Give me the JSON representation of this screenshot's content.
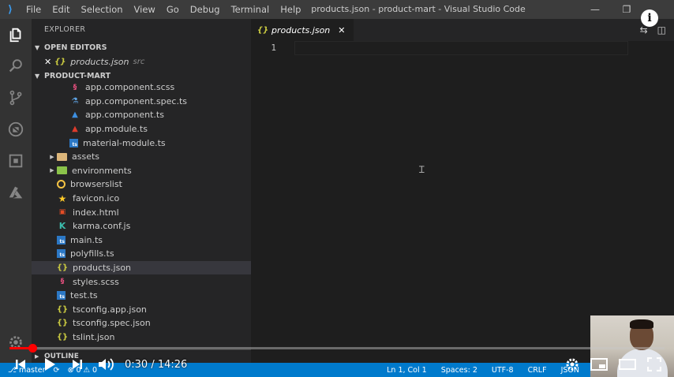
{
  "titlebar": {
    "menu": [
      "File",
      "Edit",
      "Selection",
      "View",
      "Go",
      "Debug",
      "Terminal",
      "Help"
    ],
    "window_title": "products.json - product-mart - Visual Studio Code"
  },
  "activity": [
    "files-icon",
    "search-icon",
    "source-control-icon",
    "debug-icon",
    "extensions-icon",
    "azure-icon"
  ],
  "sidebar": {
    "title": "EXPLORER",
    "open_editors_label": "OPEN EDITORS",
    "open_editor": {
      "name": "products.json",
      "desc": "src"
    },
    "project_label": "PRODUCT-MART",
    "tree": [
      {
        "name": "app.component.scss",
        "icon": "scss",
        "indent": 2
      },
      {
        "name": "app.component.spec.ts",
        "icon": "flask",
        "indent": 2
      },
      {
        "name": "app.component.ts",
        "icon": "ang-b",
        "indent": 2
      },
      {
        "name": "app.module.ts",
        "icon": "ang",
        "indent": 2
      },
      {
        "name": "material-module.ts",
        "icon": "ts",
        "indent": 2
      },
      {
        "name": "assets",
        "icon": "folder",
        "indent": 1,
        "chev": true
      },
      {
        "name": "environments",
        "icon": "folder env",
        "indent": 1,
        "chev": true
      },
      {
        "name": "browserslist",
        "icon": "circle",
        "indent": 1
      },
      {
        "name": "favicon.ico",
        "icon": "star",
        "indent": 1
      },
      {
        "name": "index.html",
        "icon": "html",
        "indent": 1
      },
      {
        "name": "karma.conf.js",
        "icon": "karma",
        "indent": 1
      },
      {
        "name": "main.ts",
        "icon": "ts",
        "indent": 1
      },
      {
        "name": "polyfills.ts",
        "icon": "ts",
        "indent": 1
      },
      {
        "name": "products.json",
        "icon": "json",
        "indent": 1,
        "selected": true
      },
      {
        "name": "styles.scss",
        "icon": "scss",
        "indent": 1
      },
      {
        "name": "test.ts",
        "icon": "ts",
        "indent": 1
      },
      {
        "name": "tsconfig.app.json",
        "icon": "json",
        "indent": 1
      },
      {
        "name": "tsconfig.spec.json",
        "icon": "json",
        "indent": 1
      },
      {
        "name": "tslint.json",
        "icon": "json",
        "indent": 1
      }
    ],
    "outline_label": "OUTLINE"
  },
  "editor": {
    "tab_name": "products.json",
    "line_numbers": [
      "1"
    ]
  },
  "statusbar": {
    "branch": "master",
    "errors": "0",
    "warnings": "0",
    "position": "Ln 1, Col 1",
    "spaces": "Spaces: 2",
    "encoding": "UTF-8",
    "eol": "CRLF",
    "language": "JSON"
  },
  "player": {
    "time": "0:30 / 14:26",
    "progress_fraction": 0.035
  }
}
